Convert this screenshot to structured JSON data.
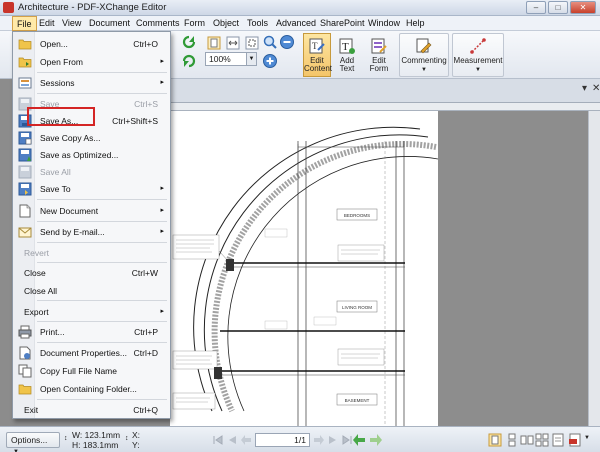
{
  "window": {
    "title": "Architecture - PDF-XChange Editor"
  },
  "menubar": {
    "items": [
      "File",
      "Edit",
      "View",
      "Document",
      "Comments",
      "Form",
      "Object",
      "Tools",
      "Advanced",
      "SharePoint",
      "Window",
      "Help"
    ]
  },
  "toolbar": {
    "zoom_value": "100%",
    "edit_content_line1": "Edit",
    "edit_content_line2": "Content",
    "add_text_line1": "Add",
    "add_text_line2": "Text",
    "edit_form_line1": "Edit",
    "edit_form_line2": "Form",
    "commenting": "Commenting",
    "measurement": "Measurement"
  },
  "file_menu": {
    "items": [
      {
        "label": "Open...",
        "shortcut": "Ctrl+O",
        "arrow": "",
        "enabled": true
      },
      {
        "label": "Open From",
        "shortcut": "",
        "arrow": "▸",
        "enabled": true
      },
      {
        "label": "Sessions",
        "shortcut": "",
        "arrow": "▸",
        "enabled": true
      },
      {
        "label": "Save",
        "shortcut": "Ctrl+S",
        "arrow": "",
        "enabled": false
      },
      {
        "label": "Save As...",
        "shortcut": "Ctrl+Shift+S",
        "arrow": "",
        "enabled": true
      },
      {
        "label": "Save Copy As...",
        "shortcut": "",
        "arrow": "",
        "enabled": true
      },
      {
        "label": "Save as Optimized...",
        "shortcut": "",
        "arrow": "",
        "enabled": true
      },
      {
        "label": "Save All",
        "shortcut": "",
        "arrow": "",
        "enabled": false
      },
      {
        "label": "Save To",
        "shortcut": "",
        "arrow": "▸",
        "enabled": true
      },
      {
        "label": "New Document",
        "shortcut": "",
        "arrow": "▸",
        "enabled": true
      },
      {
        "label": "Send by E-mail...",
        "shortcut": "",
        "arrow": "▸",
        "enabled": true
      },
      {
        "label": "Revert",
        "shortcut": "",
        "arrow": "",
        "enabled": false
      },
      {
        "label": "Close",
        "shortcut": "Ctrl+W",
        "arrow": "",
        "enabled": true
      },
      {
        "label": "Close All",
        "shortcut": "",
        "arrow": "",
        "enabled": true
      },
      {
        "label": "Export",
        "shortcut": "",
        "arrow": "▸",
        "enabled": true
      },
      {
        "label": "Print...",
        "shortcut": "Ctrl+P",
        "arrow": "",
        "enabled": true
      },
      {
        "label": "Document Properties...",
        "shortcut": "Ctrl+D",
        "arrow": "",
        "enabled": true
      },
      {
        "label": "Copy Full File Name",
        "shortcut": "",
        "arrow": "",
        "enabled": true
      },
      {
        "label": "Open Containing Folder...",
        "shortcut": "",
        "arrow": "",
        "enabled": true
      },
      {
        "label": "Exit",
        "shortcut": "Ctrl+Q",
        "arrow": "",
        "enabled": true
      }
    ]
  },
  "drawing": {
    "room_bedrooms": "BEDROOMS",
    "room_living": "LIVING ROOM",
    "room_basement": "BASEMENT"
  },
  "statusbar": {
    "options_label": "Options...",
    "width_label": "W: 123.1mm",
    "height_label": "H: 183.1mm",
    "x_label": "X:",
    "y_label": "Y:",
    "page_value": "1",
    "page_total": "/1"
  },
  "colors": {
    "menu_highlight": "#ffe9a8",
    "callout_red": "#d42525"
  }
}
